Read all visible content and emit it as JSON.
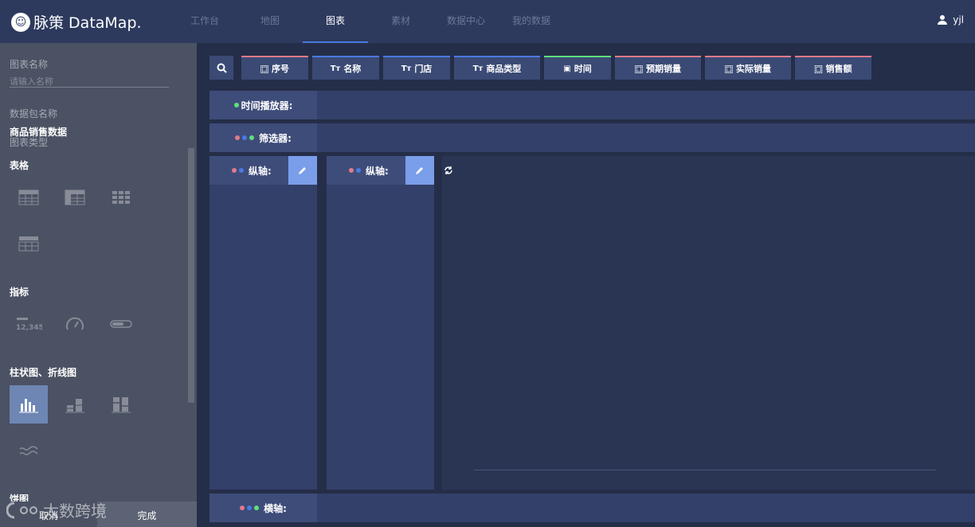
{
  "app": {
    "brand": "脉策 DataMap.",
    "logo_icon": "datamap-logo-icon"
  },
  "nav": {
    "items": [
      "工作台",
      "地图",
      "图表",
      "素材",
      "数据中心",
      "我的数据"
    ],
    "active": "图表"
  },
  "user": {
    "name": "yjl",
    "icon": "user-icon"
  },
  "sidebar": {
    "chart_name_label": "图表名称",
    "chart_name_placeholder": "请输入名称",
    "package_label": "数据包名称",
    "package_value": "商品销售数据",
    "chart_type_label": "图表类型",
    "sections": {
      "table": "表格",
      "metric": "指标",
      "bar_line": "柱状图、折线图",
      "pie": "饼图"
    },
    "cancel": "取消",
    "done": "完成"
  },
  "fields": [
    {
      "label": "序号",
      "icon": "number-icon",
      "color": "#e07a8a"
    },
    {
      "label": "名称",
      "icon": "text-icon",
      "color": "#4a7ae0"
    },
    {
      "label": "门店",
      "icon": "text-icon",
      "color": "#4a7ae0"
    },
    {
      "label": "商品类型",
      "icon": "text-icon",
      "color": "#4a7ae0"
    },
    {
      "label": "时间",
      "icon": "calendar-icon",
      "color": "#5ee07a"
    },
    {
      "label": "预期销量",
      "icon": "number-icon",
      "color": "#e07a8a"
    },
    {
      "label": "实际销量",
      "icon": "number-icon",
      "color": "#e07a8a"
    },
    {
      "label": "销售额",
      "icon": "number-icon",
      "color": "#e07a8a"
    }
  ],
  "rows": {
    "time_player": "时间播放器:",
    "filter": "筛选器:",
    "y_axis": "纵轴:",
    "x_axis": "横轴:"
  },
  "tab_prefix": {
    "text": "Tт",
    "number": "⿴",
    "calendar": "▣"
  },
  "watermark": "太数跨境",
  "colors": {
    "red": "#e07a8a",
    "blue": "#4a7ae0",
    "green": "#5ee07a",
    "accent": "#7b9eea"
  }
}
